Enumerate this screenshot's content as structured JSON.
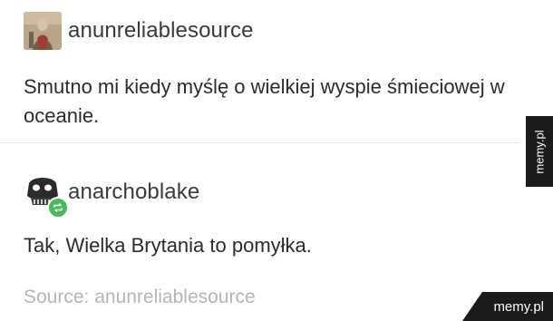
{
  "post1": {
    "username": "anunreliablesource",
    "text": "Smutno mi kiedy myślę o wielkiej wyspie śmieciowej w oceanie."
  },
  "post2": {
    "username": "anarchoblake",
    "text": "Tak, Wielka Brytania to pomyłka."
  },
  "source": "Source: anunreliablesource",
  "watermark_side": "memy.pl",
  "watermark_corner": "memy.pl",
  "colors": {
    "reblog_badge": "#4bb85c",
    "watermark_bg": "#1b1b1b"
  }
}
